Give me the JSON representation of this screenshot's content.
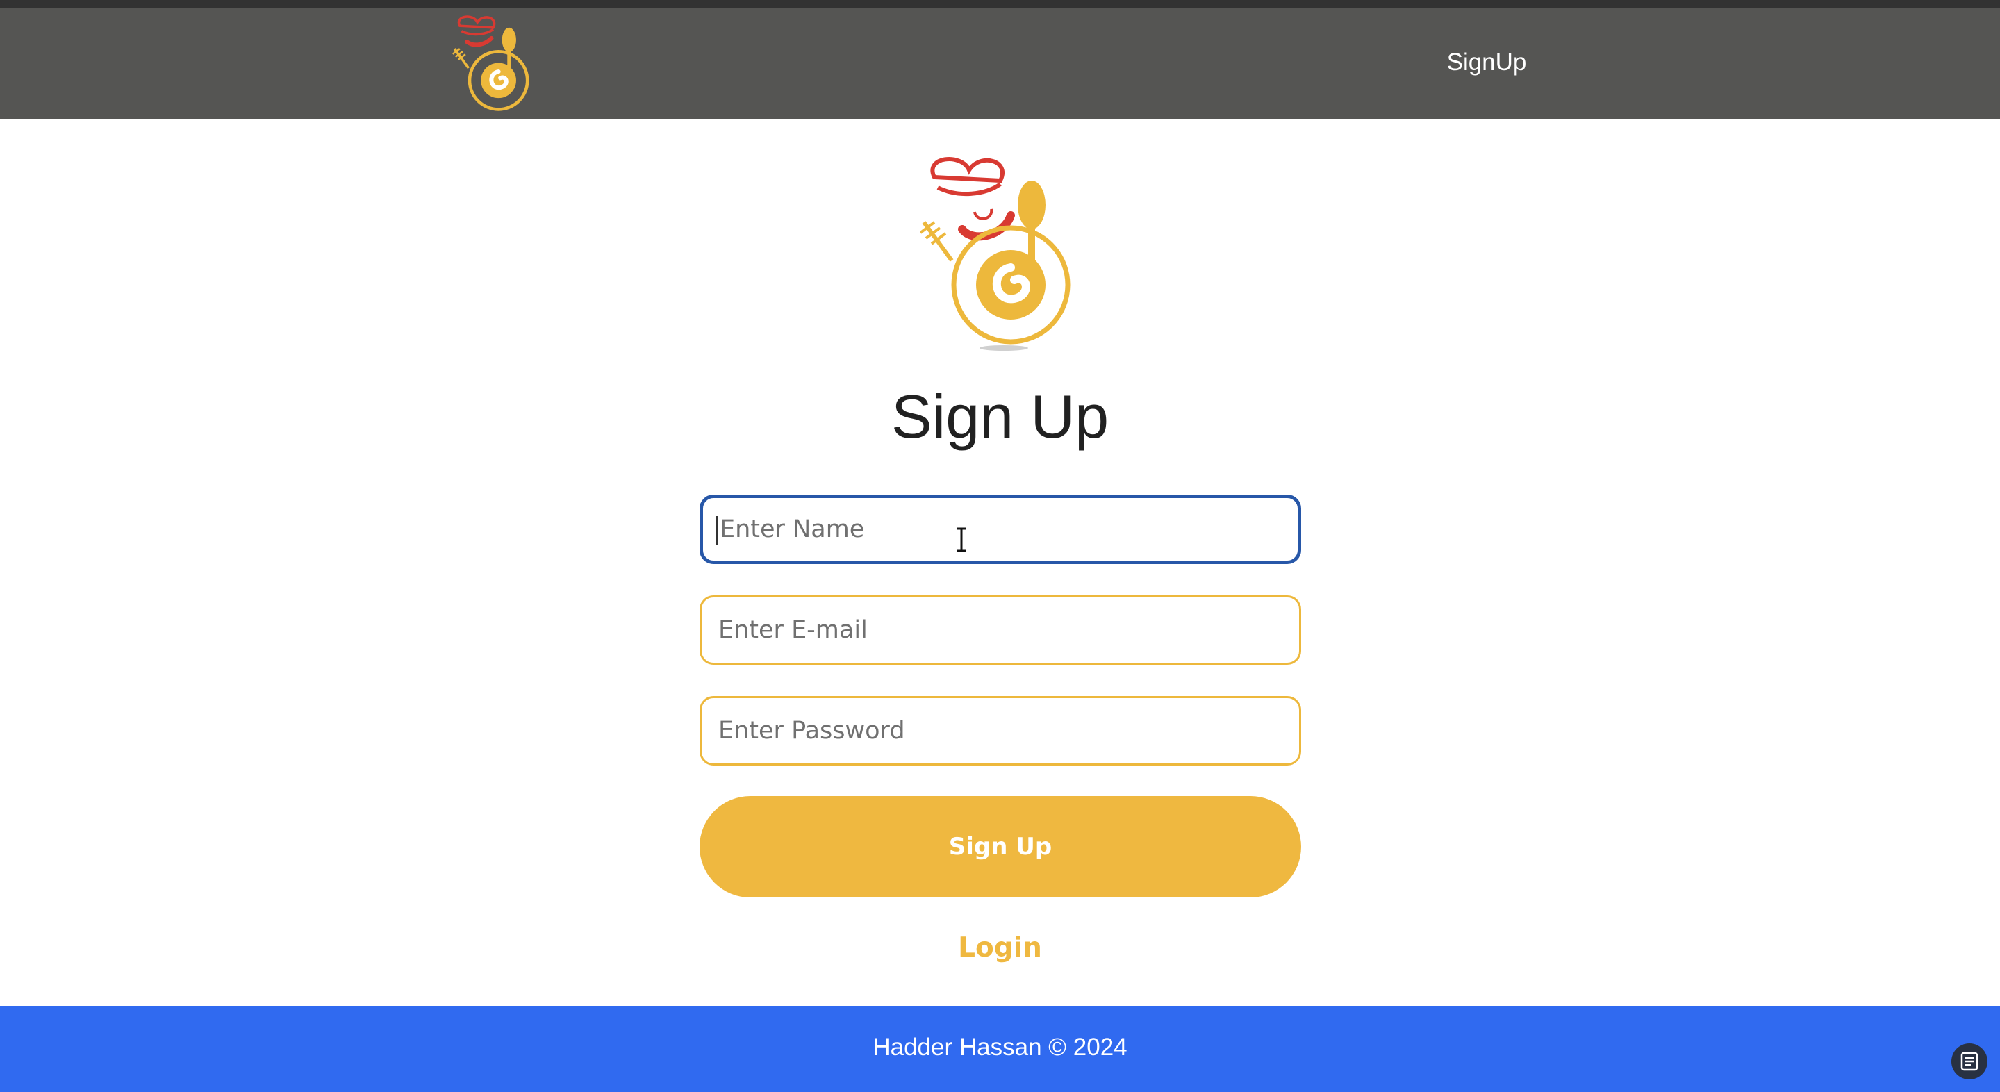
{
  "nav": {
    "logo_icon": "chef-logo-icon",
    "signup_link": "SignUp"
  },
  "main": {
    "logo_icon": "chef-logo-icon",
    "title": "Sign Up",
    "name_field": {
      "placeholder": "Enter Name",
      "value": ""
    },
    "email_field": {
      "placeholder": "Enter E-mail",
      "value": ""
    },
    "password_field": {
      "placeholder": "Enter Password",
      "value": ""
    },
    "submit_label": "Sign Up",
    "login_link": "Login"
  },
  "footer": {
    "text": "Hadder Hassan © 2024"
  },
  "floating_button_icon": "document-icon",
  "colors": {
    "navbar": "#555553",
    "accent": "#efb840",
    "focus_border": "#2757a8",
    "footer": "#306af0",
    "logo_red": "#d83a32"
  }
}
